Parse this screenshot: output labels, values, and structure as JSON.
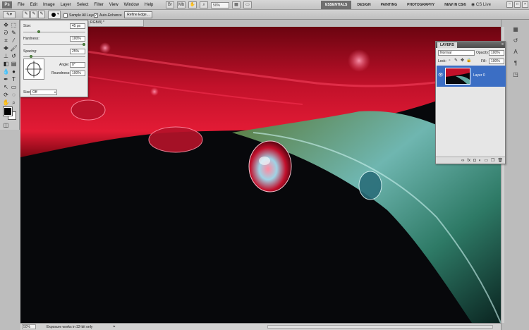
{
  "app": {
    "logo": "Ps",
    "menu": [
      "File",
      "Edit",
      "Image",
      "Layer",
      "Select",
      "Filter",
      "View",
      "Window",
      "Help"
    ],
    "zoom": "50%",
    "workspaces": [
      "ESSENTIALS",
      "DESIGN",
      "PAINTING",
      "PHOTOGRAPHY",
      "NEW IN CS 5"
    ],
    "active_workspace": "ESSENTIALS",
    "cs_live": "CS Live"
  },
  "options": {
    "sample_all_layers": "Sample All Layers",
    "auto_enhance": "Auto-Enhance",
    "auto_enhance_checked": true,
    "refine_edge": "Refine Edge..."
  },
  "document": {
    "tab_title": "RGB/8) *"
  },
  "brush_popup": {
    "size_label": "Size:",
    "size_value": "45 px",
    "hardness_label": "Hardness:",
    "hardness_value": "100%",
    "spacing_label": "Spacing:",
    "spacing_value": "25%",
    "angle_label": "Angle:",
    "angle_value": "0°",
    "roundness_label": "Roundness:",
    "roundness_value": "100%",
    "size_mode_label": "Size:",
    "size_mode_value": "Off"
  },
  "layers_panel": {
    "tab": "LAYERS",
    "blend_mode": "Normal",
    "opacity_label": "Opacity:",
    "opacity_value": "100%",
    "lock_label": "Lock:",
    "fill_label": "Fill:",
    "fill_value": "100%",
    "layer_name": "Layer 0"
  },
  "status": {
    "zoom": "50%",
    "message": "Exposure works in 32-bit only"
  },
  "colors": {
    "foreground": "#000000",
    "background": "#ffffff",
    "selected_layer": "#3b6ec4"
  }
}
